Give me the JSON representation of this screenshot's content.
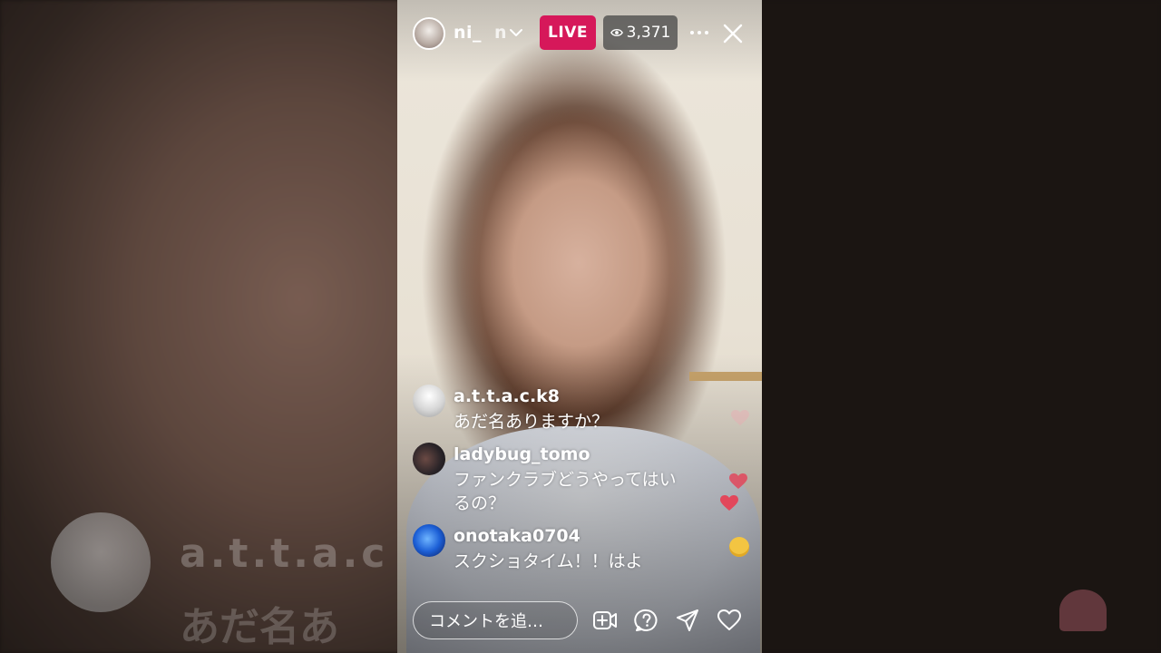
{
  "header": {
    "username": "ni_",
    "username_fade": "n",
    "live_label": "LIVE",
    "viewer_count": "3,371"
  },
  "comments": [
    {
      "user": "a.t.t.a.c.k8",
      "text": "あだ名ありますか？"
    },
    {
      "user": "ladybug_tomo",
      "text": "ファンクラブどうやってはいるの？"
    },
    {
      "user": "onotaka0704",
      "text": "スクショタイム！！はよ"
    }
  ],
  "comment_input": {
    "placeholder": "コメントを追…"
  },
  "background_overlay": {
    "text1": "a.t.t.a.c",
    "text2": "あだ名あ"
  },
  "colors": {
    "live_badge": "#d6185a",
    "viewer_badge": "#464646",
    "heart": "#e2475b"
  },
  "icons": {
    "viewer": "eye-icon",
    "more": "more-icon",
    "close": "close-icon",
    "add_video": "add-video-icon",
    "question": "question-icon",
    "share": "send-icon",
    "like": "heart-icon"
  }
}
